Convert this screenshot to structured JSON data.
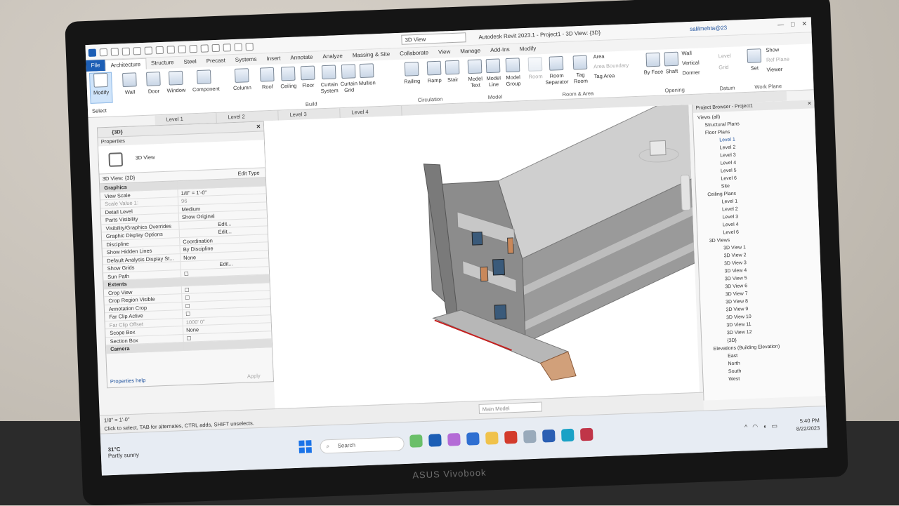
{
  "window": {
    "title": "Autodesk Revit 2023.1 - Project1 - 3D View: {3D}",
    "view_selector": "3D View",
    "user": "salilmehta@23",
    "controls": [
      "—",
      "□",
      "✕"
    ]
  },
  "ribbon_tabs": [
    "File",
    "Architecture",
    "Structure",
    "Steel",
    "Precast",
    "Systems",
    "Insert",
    "Annotate",
    "Analyze",
    "Massing & Site",
    "Collaborate",
    "View",
    "Manage",
    "Add-Ins",
    "Modify"
  ],
  "ribbon": {
    "modify": "Modify",
    "select": "Select",
    "build": [
      "Wall",
      "Door",
      "Window",
      "Component",
      "Column",
      "Roof",
      "Ceiling",
      "Floor",
      "Curtain System",
      "Curtain Grid",
      "Mullion"
    ],
    "circulation": [
      "Railing",
      "Ramp",
      "Stair"
    ],
    "model": [
      "Model Text",
      "Model Line",
      "Model Group"
    ],
    "room_area": [
      "Room",
      "Room Separator",
      "Tag Room"
    ],
    "room_area_small": [
      "Area",
      "Area Boundary",
      "Tag Area"
    ],
    "opening": [
      "By Face",
      "Shaft",
      "Wall",
      "Vertical",
      "Dormer"
    ],
    "datum": [
      "Level",
      "Grid"
    ],
    "work_plane": [
      "Set",
      "Show",
      "Ref Plane",
      "Viewer"
    ],
    "panels": [
      "Select",
      "Build",
      "Circulation",
      "Model",
      "Room & Area",
      "Opening",
      "Datum",
      "Work Plane"
    ]
  },
  "view_tabs": [
    "{3D}",
    "Level 1",
    "Level 2",
    "Level 3",
    "Level 4"
  ],
  "properties": {
    "header": "{3D}",
    "title": "Properties",
    "type_name": "3D View",
    "type_selector": "3D View: {3D}",
    "edit_type": "Edit Type",
    "rows": [
      {
        "k": "Graphics",
        "v": "",
        "section": true
      },
      {
        "k": "View Scale",
        "v": "1/8\" = 1'-0\""
      },
      {
        "k": "Scale Value    1:",
        "v": "96",
        "dim": true
      },
      {
        "k": "Detail Level",
        "v": "Medium"
      },
      {
        "k": "Parts Visibility",
        "v": "Show Original"
      },
      {
        "k": "Visibility/Graphics Overrides",
        "v": "Edit...",
        "btn": true
      },
      {
        "k": "Graphic Display Options",
        "v": "Edit...",
        "btn": true
      },
      {
        "k": "Discipline",
        "v": "Coordination"
      },
      {
        "k": "Show Hidden Lines",
        "v": "By Discipline"
      },
      {
        "k": "Default Analysis Display St...",
        "v": "None"
      },
      {
        "k": "Show Grids",
        "v": "Edit...",
        "btn": true
      },
      {
        "k": "Sun Path",
        "v": "☐"
      },
      {
        "k": "Extents",
        "v": "",
        "section": true
      },
      {
        "k": "Crop View",
        "v": "☐"
      },
      {
        "k": "Crop Region Visible",
        "v": "☐"
      },
      {
        "k": "Annotation Crop",
        "v": "☐"
      },
      {
        "k": "Far Clip Active",
        "v": "☐"
      },
      {
        "k": "Far Clip Offset",
        "v": "1000' 0\"",
        "dim": true
      },
      {
        "k": "Scope Box",
        "v": "None"
      },
      {
        "k": "Section Box",
        "v": "☐"
      },
      {
        "k": "Camera",
        "v": "",
        "section": true
      }
    ],
    "help": "Properties help",
    "apply": "Apply"
  },
  "browser": {
    "title": "Project Browser - Project1",
    "items": [
      {
        "t": "Views (all)",
        "l": 0
      },
      {
        "t": "Structural Plans",
        "l": 1
      },
      {
        "t": "Floor Plans",
        "l": 1
      },
      {
        "t": "Level 1",
        "l": 2,
        "sel": true
      },
      {
        "t": "Level 2",
        "l": 2
      },
      {
        "t": "Level 3",
        "l": 2
      },
      {
        "t": "Level 4",
        "l": 2
      },
      {
        "t": "Level 5",
        "l": 2
      },
      {
        "t": "Level 6",
        "l": 2
      },
      {
        "t": "Site",
        "l": 2
      },
      {
        "t": "Ceiling Plans",
        "l": 1
      },
      {
        "t": "Level 1",
        "l": 2
      },
      {
        "t": "Level 2",
        "l": 2
      },
      {
        "t": "Level 3",
        "l": 2
      },
      {
        "t": "Level 4",
        "l": 2
      },
      {
        "t": "Level 6",
        "l": 2
      },
      {
        "t": "3D Views",
        "l": 1
      },
      {
        "t": "3D View 1",
        "l": 2
      },
      {
        "t": "3D View 2",
        "l": 2
      },
      {
        "t": "3D View 3",
        "l": 2
      },
      {
        "t": "3D View 4",
        "l": 2
      },
      {
        "t": "3D View 5",
        "l": 2
      },
      {
        "t": "3D View 6",
        "l": 2
      },
      {
        "t": "3D View 7",
        "l": 2
      },
      {
        "t": "3D View 8",
        "l": 2
      },
      {
        "t": "3D View 9",
        "l": 2
      },
      {
        "t": "3D View 10",
        "l": 2
      },
      {
        "t": "3D View 11",
        "l": 2
      },
      {
        "t": "3D View 12",
        "l": 2
      },
      {
        "t": "{3D}",
        "l": 2
      },
      {
        "t": "Elevations (Building Elevation)",
        "l": 1
      },
      {
        "t": "East",
        "l": 2
      },
      {
        "t": "North",
        "l": 2
      },
      {
        "t": "South",
        "l": 2
      },
      {
        "t": "West",
        "l": 2
      }
    ]
  },
  "status": {
    "scale": "1/8\" = 1'-0\"",
    "message": "Click to select, TAB for alternates, CTRL adds, SHIFT unselects.",
    "main_model": "Main Model"
  },
  "taskbar": {
    "weather_temp": "31°C",
    "weather_desc": "Partly sunny",
    "search": "Search",
    "time": "5:40 PM",
    "date": "8/22/2023"
  },
  "laptop": {
    "brand": "ASUS Vivobook"
  },
  "colors": {
    "ribbon_blue": "#1c5eb5",
    "building_gray": "#9a9a9a",
    "accent_brown": "#c9885a"
  }
}
